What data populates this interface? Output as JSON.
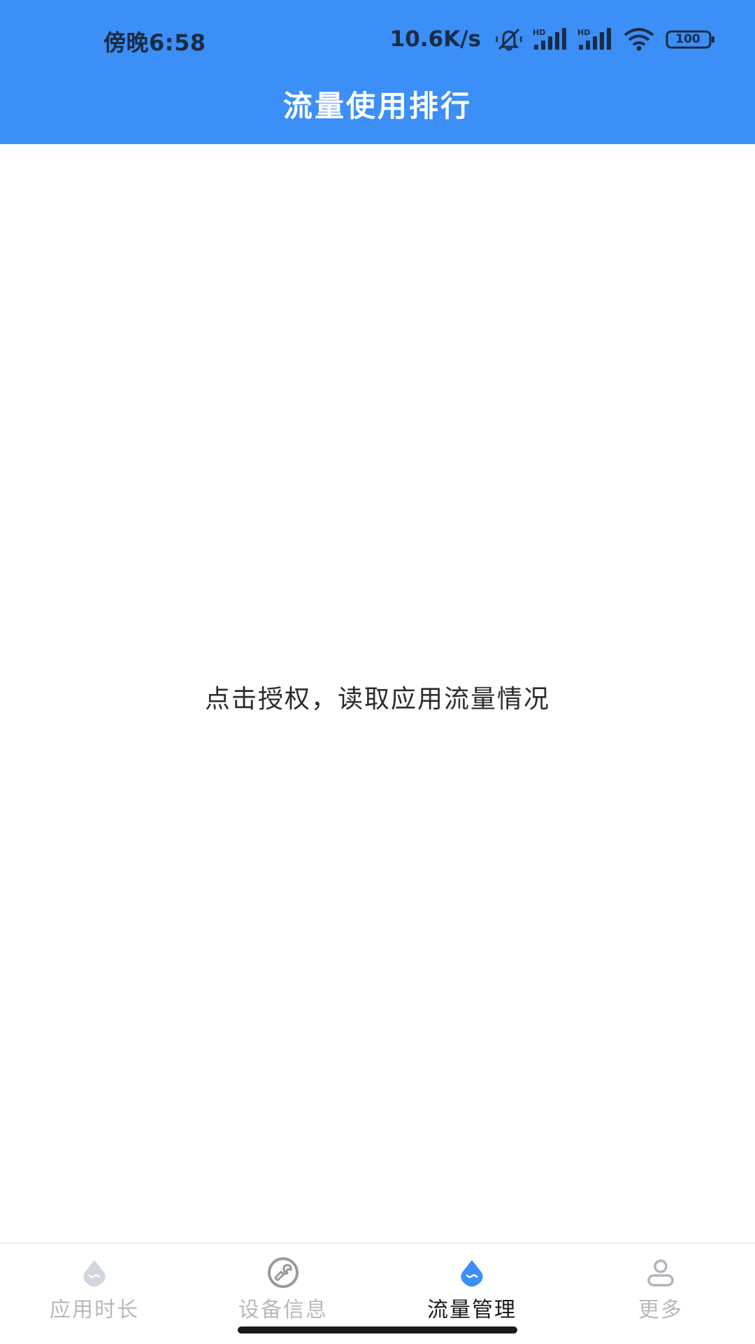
{
  "status_bar": {
    "time": "傍晚6:58",
    "net_speed": "10.6K/s",
    "battery": "100",
    "icons": [
      "mute-bell-icon",
      "signal-hd-icon",
      "signal-hd-icon",
      "wifi-icon",
      "battery-icon"
    ]
  },
  "header": {
    "title": "流量使用排行"
  },
  "main": {
    "prompt": "点击授权，读取应用流量情况"
  },
  "bottom_nav": {
    "items": [
      {
        "label": "应用时长",
        "icon": "droplet-icon",
        "active": false
      },
      {
        "label": "设备信息",
        "icon": "wrench-icon",
        "active": false
      },
      {
        "label": "流量管理",
        "icon": "droplet-icon",
        "active": true
      },
      {
        "label": "更多",
        "icon": "person-icon",
        "active": false
      }
    ]
  },
  "colors": {
    "primary": "#3b8ff6",
    "active_label": "#1a1a1a",
    "inactive_label": "#b9b9b9",
    "inactive_icon": "#c8cdd6"
  }
}
